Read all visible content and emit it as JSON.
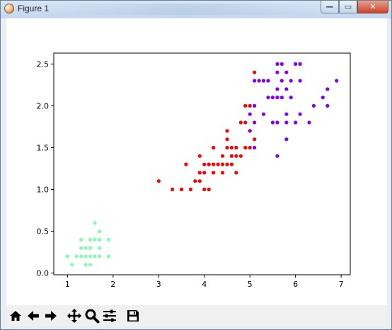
{
  "window": {
    "title": "Figure 1",
    "minimize_glyph": "—",
    "maximize_glyph": "▭",
    "close_glyph": "✕"
  },
  "toolbar": {
    "buttons": [
      "home-icon",
      "back-arrow-icon",
      "forward-arrow-icon",
      "pan-icon",
      "zoom-icon",
      "configure-subplots-icon",
      "save-icon"
    ]
  },
  "chart_data": {
    "type": "scatter",
    "title": "",
    "xlabel": "",
    "ylabel": "",
    "xlim": [
      0.7,
      7.2
    ],
    "ylim": [
      -0.02,
      2.63
    ],
    "xticks": [
      1,
      2,
      3,
      4,
      5,
      6,
      7
    ],
    "yticks": [
      0.0,
      0.5,
      1.0,
      1.5,
      2.0,
      2.5
    ],
    "xtick_labels": [
      "1",
      "2",
      "3",
      "4",
      "5",
      "6",
      "7"
    ],
    "ytick_labels": [
      "0.0",
      "0.5",
      "1.0",
      "1.5",
      "2.0",
      "2.5"
    ],
    "grid": false,
    "series": [
      {
        "color": "#7fffb0",
        "points": [
          [
            1.0,
            0.2
          ],
          [
            1.1,
            0.1
          ],
          [
            1.2,
            0.2
          ],
          [
            1.3,
            0.2
          ],
          [
            1.4,
            0.2
          ],
          [
            1.5,
            0.2
          ],
          [
            1.6,
            0.2
          ],
          [
            1.7,
            0.2
          ],
          [
            1.9,
            0.2
          ],
          [
            1.3,
            0.3
          ],
          [
            1.4,
            0.3
          ],
          [
            1.5,
            0.3
          ],
          [
            1.7,
            0.3
          ],
          [
            1.3,
            0.4
          ],
          [
            1.5,
            0.4
          ],
          [
            1.6,
            0.4
          ],
          [
            1.7,
            0.4
          ],
          [
            1.9,
            0.4
          ],
          [
            1.4,
            0.1
          ],
          [
            1.5,
            0.1
          ],
          [
            1.6,
            0.6
          ],
          [
            1.7,
            0.5
          ]
        ]
      },
      {
        "color": "#ff0000",
        "points": [
          [
            3.0,
            1.1
          ],
          [
            3.3,
            1.0
          ],
          [
            3.5,
            1.0
          ],
          [
            3.6,
            1.3
          ],
          [
            3.7,
            1.0
          ],
          [
            3.8,
            1.1
          ],
          [
            3.9,
            1.1
          ],
          [
            3.9,
            1.2
          ],
          [
            3.9,
            1.4
          ],
          [
            4.0,
            1.0
          ],
          [
            4.0,
            1.2
          ],
          [
            4.0,
            1.3
          ],
          [
            4.1,
            1.0
          ],
          [
            4.1,
            1.3
          ],
          [
            4.2,
            1.2
          ],
          [
            4.2,
            1.3
          ],
          [
            4.2,
            1.5
          ],
          [
            4.3,
            1.3
          ],
          [
            4.4,
            1.2
          ],
          [
            4.4,
            1.3
          ],
          [
            4.4,
            1.4
          ],
          [
            4.5,
            1.3
          ],
          [
            4.5,
            1.5
          ],
          [
            4.5,
            1.6
          ],
          [
            4.5,
            1.7
          ],
          [
            4.6,
            1.3
          ],
          [
            4.6,
            1.4
          ],
          [
            4.6,
            1.5
          ],
          [
            4.7,
            1.2
          ],
          [
            4.7,
            1.4
          ],
          [
            4.7,
            1.5
          ],
          [
            4.8,
            1.4
          ],
          [
            4.8,
            1.8
          ],
          [
            4.9,
            1.5
          ],
          [
            4.9,
            1.8
          ],
          [
            4.9,
            2.0
          ],
          [
            5.0,
            1.5
          ],
          [
            5.0,
            1.7
          ],
          [
            5.0,
            2.0
          ],
          [
            5.1,
            1.6
          ],
          [
            5.1,
            2.4
          ]
        ]
      },
      {
        "color": "#8000ff",
        "points": [
          [
            5.0,
            1.7
          ],
          [
            5.0,
            1.9
          ],
          [
            5.1,
            1.5
          ],
          [
            5.1,
            1.8
          ],
          [
            5.1,
            2.0
          ],
          [
            5.1,
            2.3
          ],
          [
            5.2,
            2.3
          ],
          [
            5.3,
            2.3
          ],
          [
            5.3,
            1.9
          ],
          [
            5.4,
            2.1
          ],
          [
            5.4,
            2.3
          ],
          [
            5.5,
            2.1
          ],
          [
            5.5,
            1.8
          ],
          [
            5.6,
            2.1
          ],
          [
            5.6,
            2.4
          ],
          [
            5.6,
            1.8
          ],
          [
            5.6,
            2.2
          ],
          [
            5.6,
            1.4
          ],
          [
            5.7,
            2.1
          ],
          [
            5.7,
            2.3
          ],
          [
            5.7,
            2.5
          ],
          [
            5.8,
            1.6
          ],
          [
            5.8,
            1.8
          ],
          [
            5.8,
            2.2
          ],
          [
            5.9,
            2.1
          ],
          [
            5.9,
            2.3
          ],
          [
            6.0,
            2.5
          ],
          [
            6.0,
            1.8
          ],
          [
            6.1,
            2.5
          ],
          [
            6.1,
            1.9
          ],
          [
            6.1,
            2.3
          ],
          [
            6.3,
            1.8
          ],
          [
            6.4,
            2.0
          ],
          [
            6.6,
            2.1
          ],
          [
            6.7,
            2.0
          ],
          [
            6.7,
            2.2
          ],
          [
            6.9,
            2.3
          ],
          [
            5.8,
            2.4
          ],
          [
            5.6,
            2.5
          ],
          [
            5.8,
            1.9
          ]
        ]
      }
    ]
  }
}
